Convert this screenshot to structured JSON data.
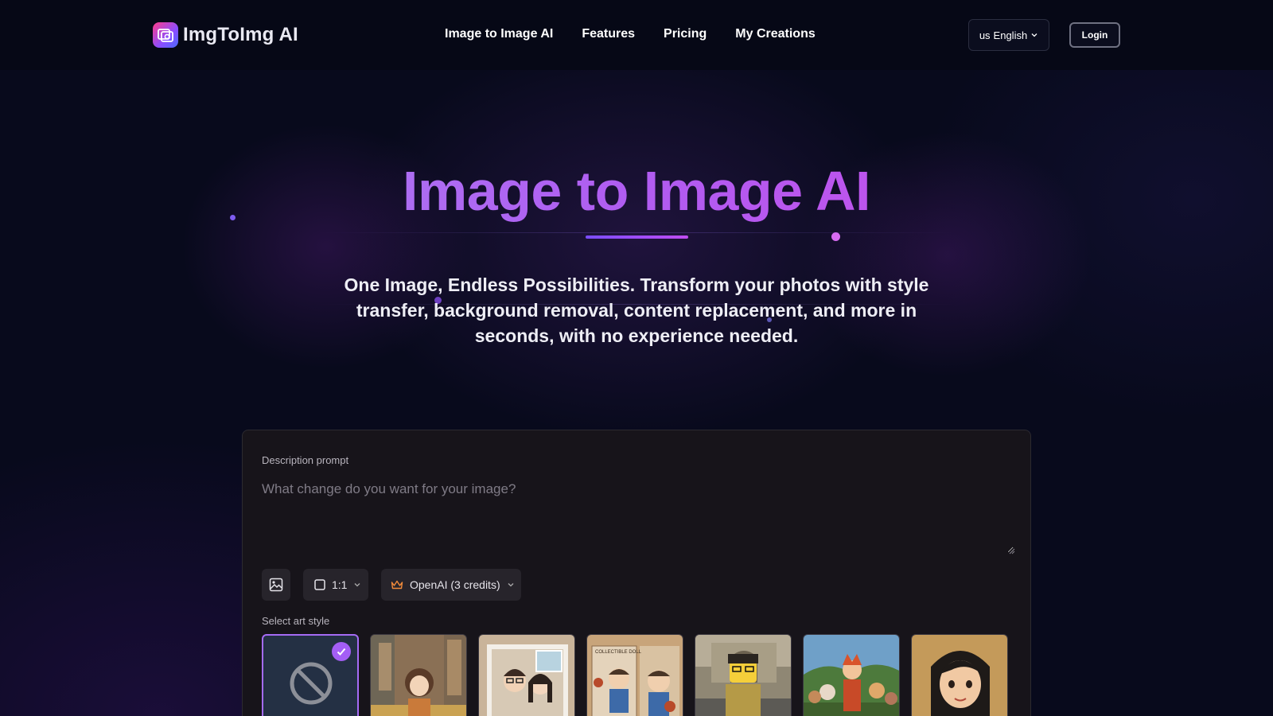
{
  "brand": {
    "name": "ImgToImg AI"
  },
  "nav": {
    "items": [
      {
        "label": "Image to Image AI"
      },
      {
        "label": "Features"
      },
      {
        "label": "Pricing"
      },
      {
        "label": "My Creations"
      }
    ]
  },
  "header": {
    "language": {
      "flag": "us",
      "label": "English"
    },
    "login_label": "Login"
  },
  "hero": {
    "title": "Image to Image AI",
    "subtitle": "One Image, Endless Possibilities. Transform your photos with style transfer, background removal, content replacement, and more in seconds, with no experience needed."
  },
  "editor": {
    "prompt_label": "Description prompt",
    "prompt_placeholder": "What change do you want for your image?",
    "aspect_ratio": "1:1",
    "model": "OpenAI (3 credits)",
    "style_label": "Select art style",
    "styles": [
      {
        "name": "none",
        "selected": true
      },
      {
        "name": "anime-city-girl",
        "selected": false
      },
      {
        "name": "couple-photo-frame",
        "selected": false
      },
      {
        "name": "collectible-doll",
        "selected": false
      },
      {
        "name": "lego-figure",
        "selected": false
      },
      {
        "name": "cartoon-characters",
        "selected": false
      },
      {
        "name": "cartoon-portrait",
        "selected": false
      }
    ],
    "doll_box_text": "COLLECTIBLE DOLL"
  },
  "colors": {
    "accent": "#a45ef5",
    "title_gradient_start": "#a88af5",
    "title_gradient_end": "#d347e6",
    "panel_bg": "#17141a"
  }
}
